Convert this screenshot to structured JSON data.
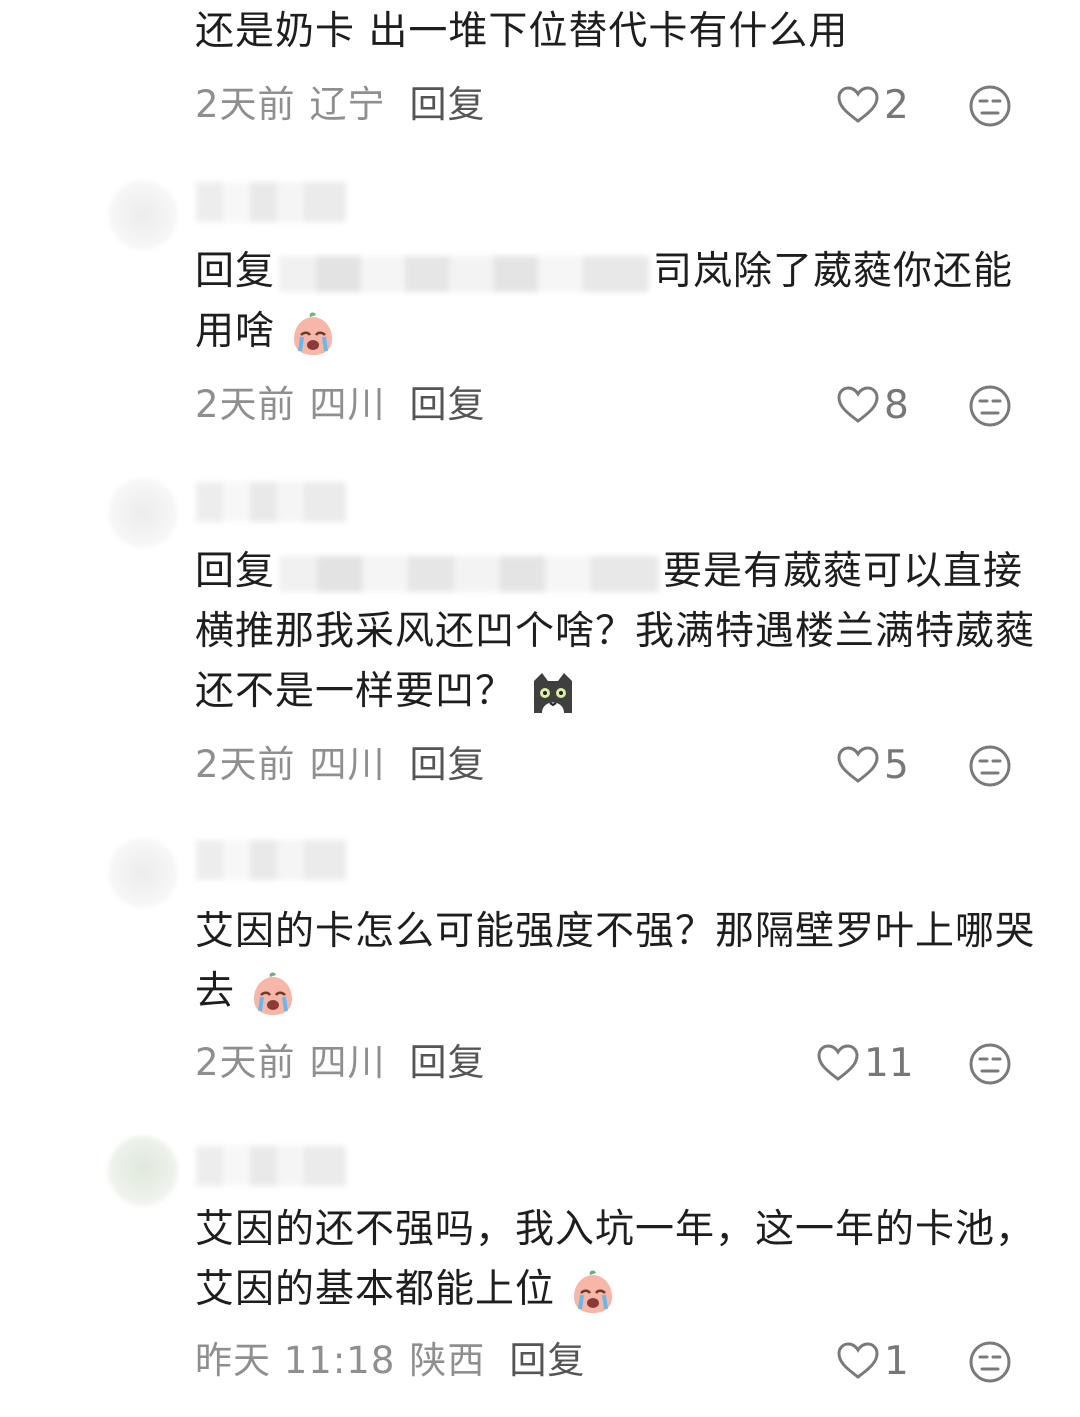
{
  "comments": [
    {
      "text": "还是奶卡 出一堆下位替代卡有什么用",
      "time": "2天前",
      "location": "辽宁",
      "reply_label": "回复",
      "likes": "2"
    },
    {
      "reply_prefix": "回复",
      "text": "司岚除了葳蕤你还能用啥",
      "emoji": "crying-peach-emoji",
      "time": "2天前",
      "location": "四川",
      "reply_label": "回复",
      "likes": "8"
    },
    {
      "reply_prefix": "回复",
      "text": "要是有葳蕤可以直接横推那我采风还凹个啥？我满特遇楼兰满特葳蕤还不是一样要凹？",
      "emoji": "cat-emoji",
      "time": "2天前",
      "location": "四川",
      "reply_label": "回复",
      "likes": "5"
    },
    {
      "text": "艾因的卡怎么可能强度不强？那隔壁罗叶上哪哭去",
      "emoji": "crying-peach-emoji",
      "time": "2天前",
      "location": "四川",
      "reply_label": "回复",
      "likes": "11"
    },
    {
      "text": "艾因的还不强吗，我入坑一年，这一年的卡池，艾因的基本都能上位",
      "emoji": "crying-peach-emoji",
      "time": "昨天 11:18",
      "location": "陕西",
      "reply_label": "回复",
      "likes": "1"
    }
  ],
  "icons": {
    "like": "heart-outline-icon",
    "dislike": "neutral-face-icon"
  },
  "colors": {
    "text": "#1e1e1e",
    "meta": "#8f8f8f",
    "reply": "#555555",
    "icon": "#7a7a7a"
  }
}
